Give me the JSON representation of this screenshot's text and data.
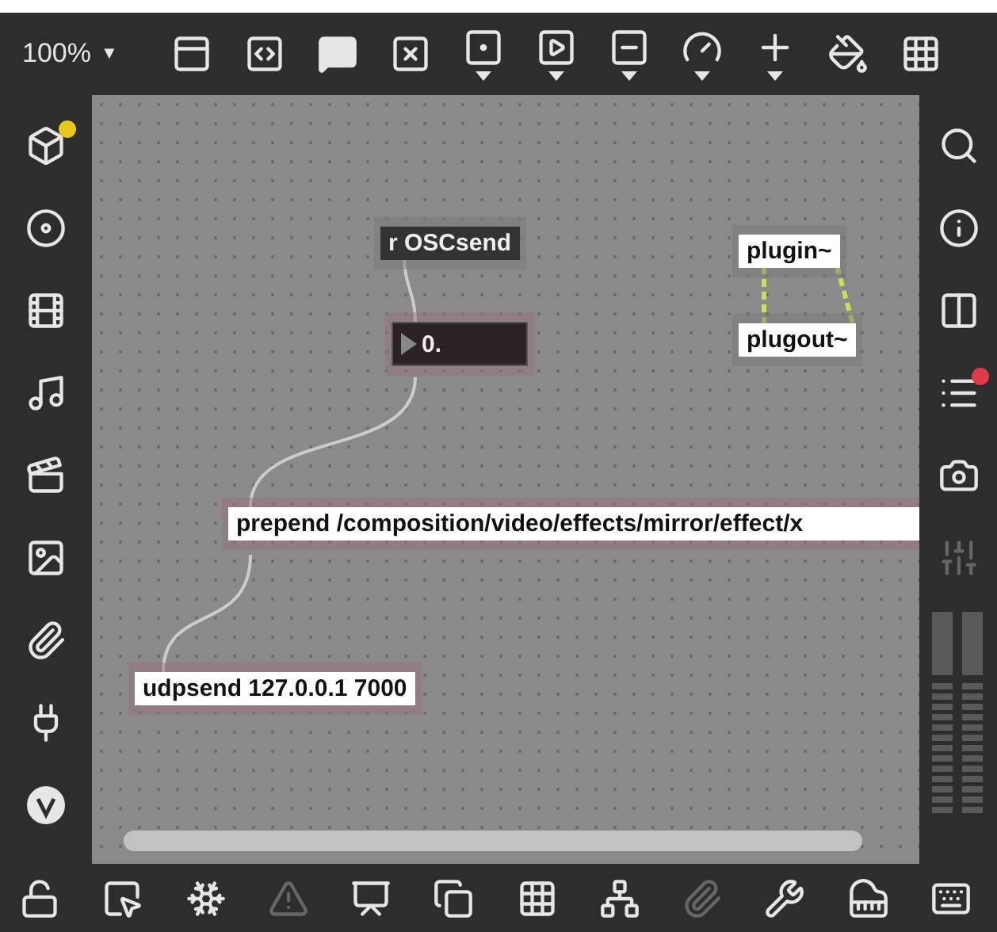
{
  "toolbar": {
    "zoom": "100%",
    "zoom_caret": "▼"
  },
  "patcher": {
    "objects": [
      {
        "kind": "receive",
        "text": "r OSCsend",
        "selected": false
      },
      {
        "kind": "number",
        "text": "0.",
        "selected": true
      },
      {
        "kind": "object",
        "text": "plugin~",
        "selected": false
      },
      {
        "kind": "object",
        "text": "plugout~",
        "selected": false
      },
      {
        "kind": "object",
        "text": "prepend /composition/video/effects/mirror/effect/x",
        "selected": true
      },
      {
        "kind": "object",
        "text": "udpsend 127.0.0.1 7000",
        "selected": true
      }
    ]
  }
}
